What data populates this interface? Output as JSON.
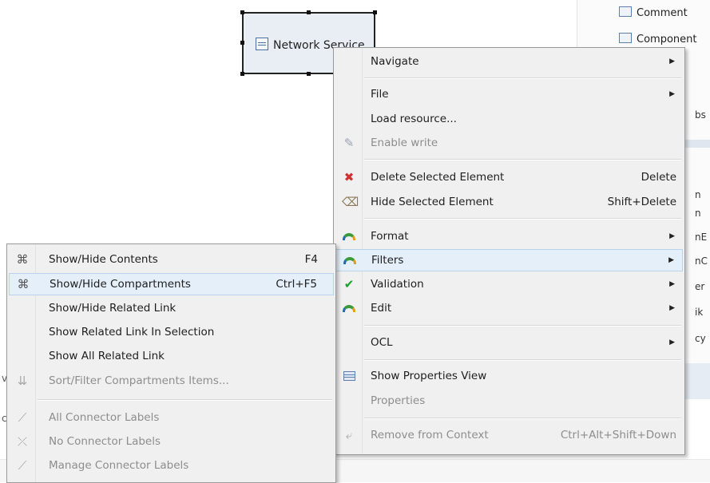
{
  "diagram": {
    "node_label": "Network Service"
  },
  "palette": {
    "items": [
      "Comment",
      "Component"
    ],
    "fragments": [
      "bs",
      "n",
      "n",
      "nE",
      "nC",
      "er",
      "ik",
      "cy"
    ]
  },
  "left_fragments": [
    "v",
    "c"
  ],
  "main_menu": {
    "items": [
      {
        "label": "Navigate",
        "shortcut": "",
        "submenu": true,
        "disabled": false,
        "icon": ""
      },
      {
        "label": "File",
        "shortcut": "",
        "submenu": true,
        "disabled": false,
        "icon": ""
      },
      {
        "label": "Load resource...",
        "shortcut": "",
        "submenu": false,
        "disabled": false,
        "icon": ""
      },
      {
        "label": "Enable write",
        "shortcut": "",
        "submenu": false,
        "disabled": true,
        "icon": "pencil-icon"
      },
      {
        "label": "Delete Selected Element",
        "shortcut": "Delete",
        "submenu": false,
        "disabled": false,
        "icon": "delete-icon"
      },
      {
        "label": "Hide Selected Element",
        "shortcut": "Shift+Delete",
        "submenu": false,
        "disabled": false,
        "icon": "eraser-icon"
      },
      {
        "label": "Format",
        "shortcut": "",
        "submenu": true,
        "disabled": false,
        "icon": "swirl-icon"
      },
      {
        "label": "Filters",
        "shortcut": "",
        "submenu": true,
        "disabled": false,
        "icon": "swirl-icon",
        "highlighted": true
      },
      {
        "label": "Validation",
        "shortcut": "",
        "submenu": true,
        "disabled": false,
        "icon": "check-icon"
      },
      {
        "label": "Edit",
        "shortcut": "",
        "submenu": true,
        "disabled": false,
        "icon": "swirl-icon"
      },
      {
        "label": "OCL",
        "shortcut": "",
        "submenu": true,
        "disabled": false,
        "icon": ""
      },
      {
        "label": "Show Properties View",
        "shortcut": "",
        "submenu": false,
        "disabled": false,
        "icon": "properties-icon"
      },
      {
        "label": "Properties",
        "shortcut": "",
        "submenu": false,
        "disabled": true,
        "icon": ""
      },
      {
        "label": "Remove from Context",
        "shortcut": "Ctrl+Alt+Shift+Down",
        "submenu": false,
        "disabled": true,
        "icon": "remove-context-icon"
      }
    ]
  },
  "sub_menu": {
    "items": [
      {
        "label": "Show/Hide Contents",
        "shortcut": "F4",
        "disabled": false,
        "icon": "show-hide-contents-icon"
      },
      {
        "label": "Show/Hide Compartments",
        "shortcut": "Ctrl+F5",
        "disabled": false,
        "icon": "show-hide-compartments-icon",
        "highlighted": true
      },
      {
        "label": "Show/Hide Related Link",
        "shortcut": "",
        "disabled": false,
        "icon": ""
      },
      {
        "label": "Show Related Link In Selection",
        "shortcut": "",
        "disabled": false,
        "icon": ""
      },
      {
        "label": "Show All Related Link",
        "shortcut": "",
        "disabled": false,
        "icon": ""
      },
      {
        "label": "Sort/Filter Compartments Items...",
        "shortcut": "",
        "disabled": true,
        "icon": "sort-filter-icon"
      },
      {
        "label": "All Connector Labels",
        "shortcut": "",
        "disabled": true,
        "icon": "all-labels-icon"
      },
      {
        "label": "No Connector Labels",
        "shortcut": "",
        "disabled": true,
        "icon": "no-labels-icon"
      },
      {
        "label": "Manage Connector Labels",
        "shortcut": "",
        "disabled": true,
        "icon": "manage-labels-icon"
      }
    ]
  }
}
